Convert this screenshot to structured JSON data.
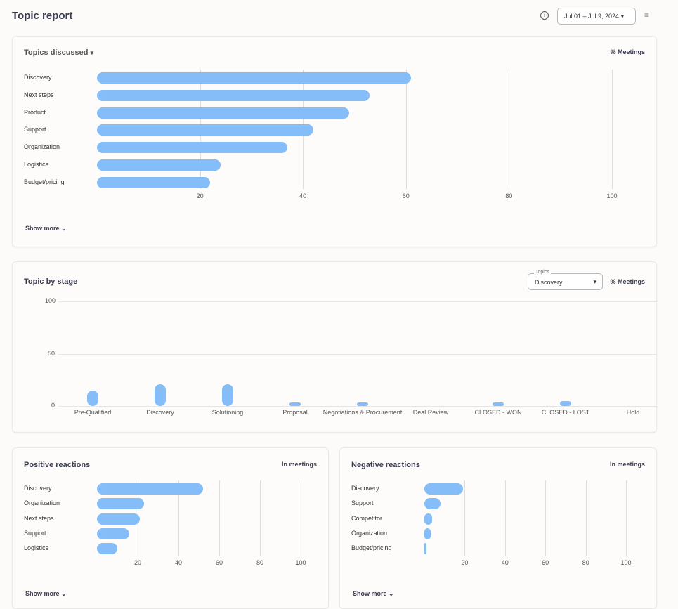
{
  "header": {
    "title": "Topic report",
    "date_range": "Jul 01 – Jul 9, 2024"
  },
  "topics_discussed": {
    "title": "Topics discussed",
    "unit": "% Meetings",
    "show_more": "Show more"
  },
  "topic_by_stage": {
    "title": "Topic by stage",
    "unit": "% Meetings",
    "select_label": "Topics",
    "select_value": "Discovery"
  },
  "positive": {
    "title": "Positive reactions",
    "unit": "In meetings",
    "show_more": "Show more"
  },
  "negative": {
    "title": "Negative reactions",
    "unit": "In meetings",
    "show_more": "Show more"
  },
  "colors": {
    "bar": "#84bdf7"
  },
  "chart_data": [
    {
      "type": "bar",
      "orientation": "horizontal",
      "title": "Topics discussed",
      "categories": [
        "Discovery",
        "Next steps",
        "Product",
        "Support",
        "Organization",
        "Logistics",
        "Budget/pricing"
      ],
      "values": [
        61,
        53,
        49,
        42,
        37,
        24,
        22
      ],
      "ticks": [
        "20",
        "40",
        "60",
        "80",
        "100"
      ],
      "xlim": [
        0,
        100
      ]
    },
    {
      "type": "bar",
      "title": "Topic by stage",
      "categories": [
        "Pre-Qualified",
        "Discovery",
        "Solutioning",
        "Proposal",
        "Negotiations & Procurement",
        "Deal Review",
        "CLOSED - WON",
        "CLOSED - LOST",
        "Hold"
      ],
      "values": [
        15,
        21,
        21,
        3,
        3,
        0,
        2,
        5,
        0
      ],
      "ticks": [
        "0",
        "50",
        "100"
      ],
      "ylim": [
        0,
        100
      ]
    },
    {
      "type": "bar",
      "orientation": "horizontal",
      "title": "Positive reactions",
      "categories": [
        "Discovery",
        "Organization",
        "Next steps",
        "Support",
        "Logistics"
      ],
      "values": [
        52,
        23,
        21,
        16,
        10
      ],
      "ticks": [
        "20",
        "40",
        "60",
        "80",
        "100"
      ],
      "xlim": [
        0,
        100
      ]
    },
    {
      "type": "bar",
      "orientation": "horizontal",
      "title": "Negative reactions",
      "categories": [
        "Discovery",
        "Support",
        "Competitor",
        "Organization",
        "Budget/pricing"
      ],
      "values": [
        19,
        8,
        4,
        3,
        1
      ],
      "ticks": [
        "20",
        "40",
        "60",
        "80",
        "100"
      ],
      "xlim": [
        0,
        100
      ]
    }
  ]
}
